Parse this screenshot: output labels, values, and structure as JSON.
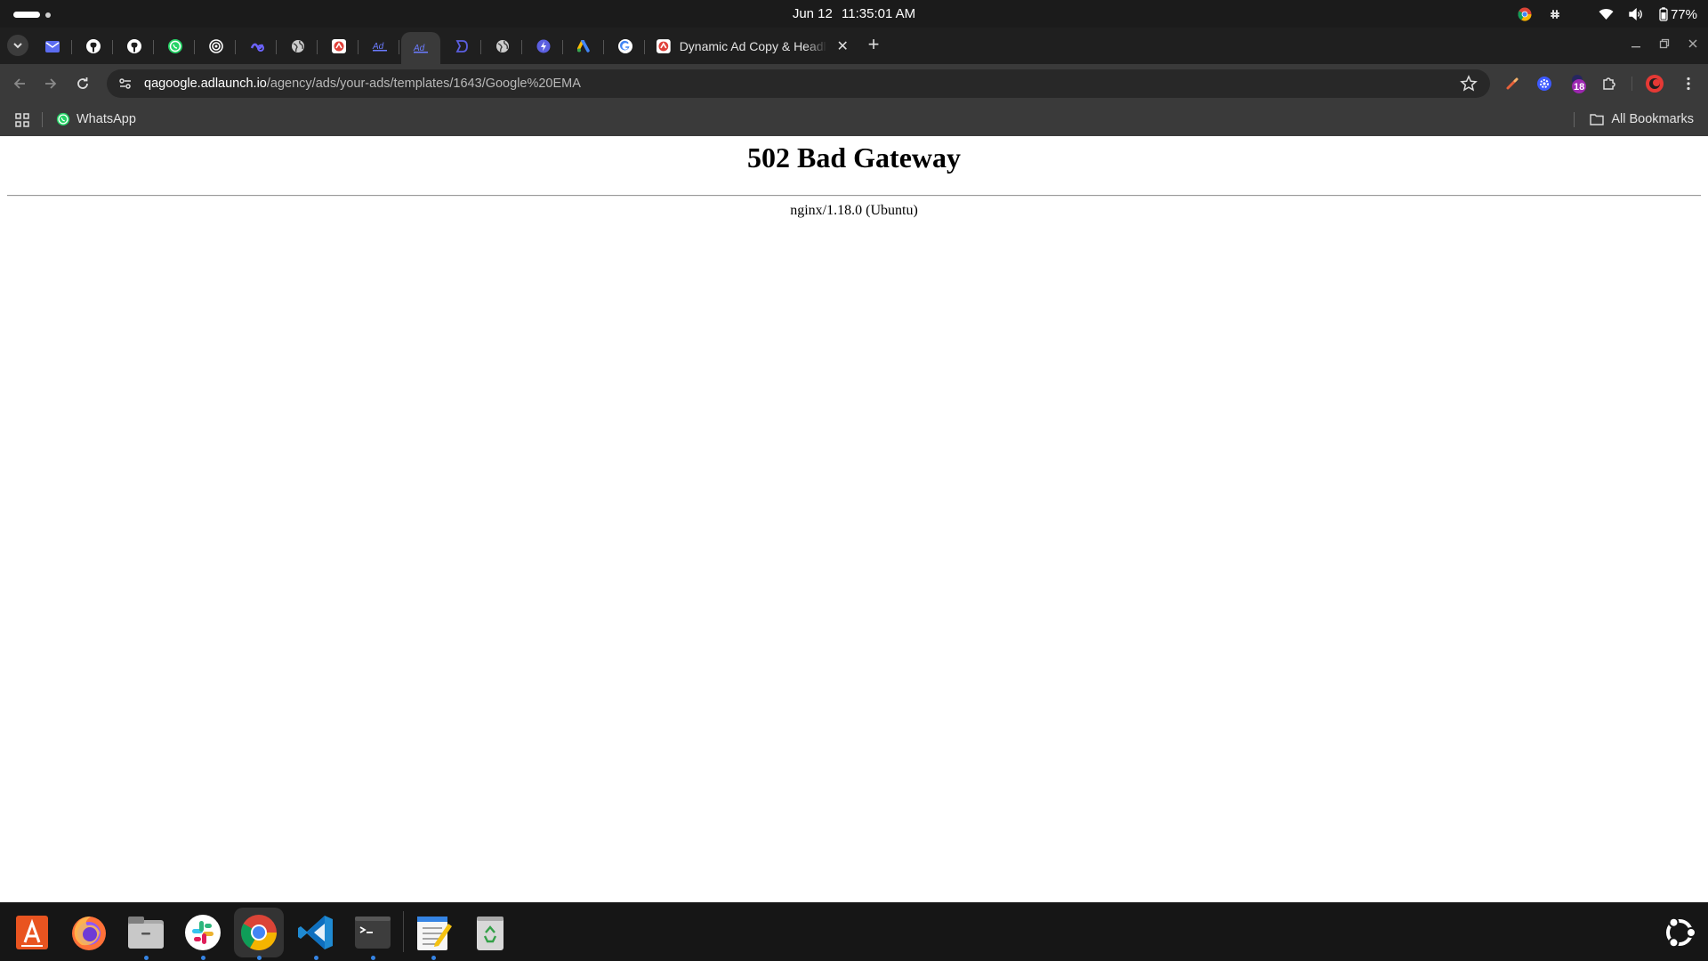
{
  "topbar": {
    "date": "Jun 12",
    "time": "11:35:01 AM",
    "battery_percent": "77%"
  },
  "tabs": {
    "pinned_icons": [
      "gmail-icon",
      "github-icon",
      "github-icon",
      "whatsapp-icon",
      "target-icon",
      "infinity-icon",
      "globe-icon",
      "adlaunch-icon",
      "adlaunch-icon",
      "adlaunch-icon",
      "bracket-icon",
      "globe-icon",
      "bolt-icon",
      "google-ads-icon",
      "google-icon"
    ],
    "active_tab_title": "Dynamic Ad Copy & Headline",
    "new_tab_label": "+"
  },
  "omnibox": {
    "url_host": "qagoogle.adlaunch.io",
    "url_path": "/agency/ads/your-ads/templates/1643/Google%20EMA"
  },
  "extensions": {
    "badge_count": "18"
  },
  "bookmarks": {
    "whatsapp_label": "WhatsApp",
    "all_bookmarks_label": "All Bookmarks"
  },
  "page": {
    "title": "502 Bad Gateway",
    "server_signature": "nginx/1.18.0 (Ubuntu)"
  },
  "dock": {
    "apps": [
      "app-center",
      "firefox",
      "files",
      "slack",
      "chrome",
      "vscode",
      "terminal",
      "text-editor",
      "trash"
    ],
    "colors": {
      "accent": "#3584e4",
      "ubuntu_orange": "#e95420"
    }
  }
}
